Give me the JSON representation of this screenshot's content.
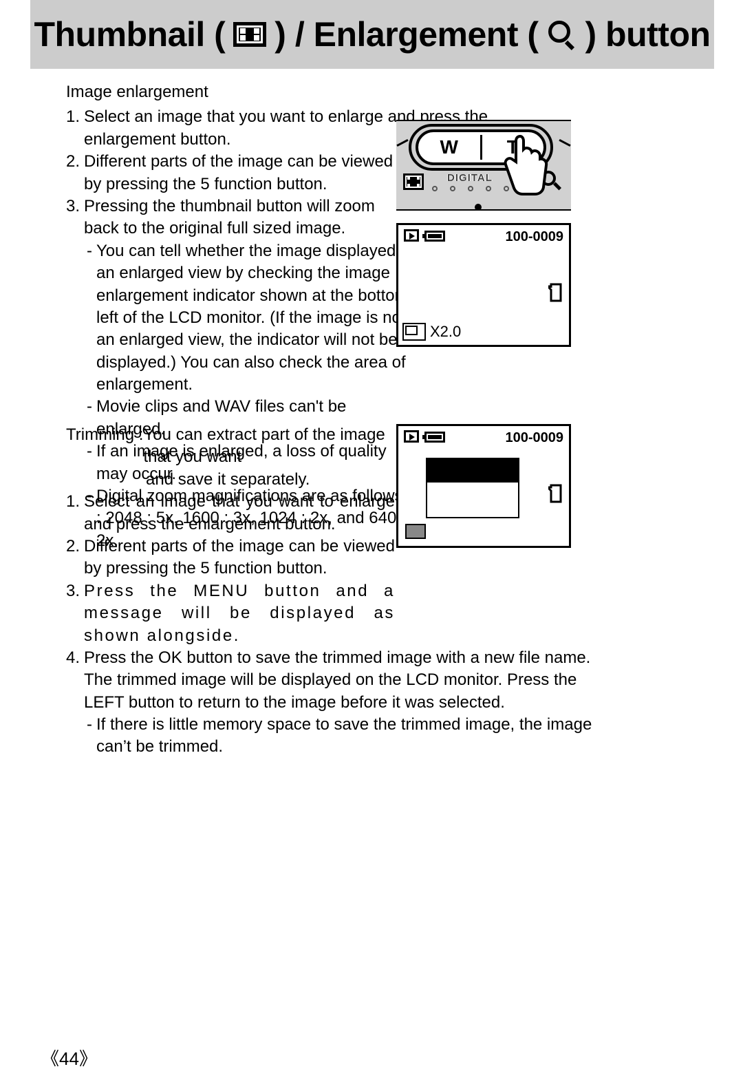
{
  "title": {
    "part1": "Thumbnail (",
    "part2": ") / Enlargement (",
    "part3": ") button"
  },
  "section1": {
    "heading": "Image enlargement",
    "items": [
      "Select an image that you want to enlarge and press the enlargement button.",
      "Different parts of the image can be viewed by pressing the 5 function button.",
      "Pressing the thumbnail button will zoom back to the original full sized image."
    ],
    "subitems": [
      "You can tell whether the image displayed is an enlarged view by checking the image enlargement indicator shown at the bottom left of the LCD monitor. (If the image is not an enlarged view, the indicator will not be displayed.) You can also check the area of enlargement.",
      "Movie clips and WAV files can't be enlarged.",
      "If an image is enlarged, a loss of quality may occur.",
      "Digital zoom magnifications are as follows"
    ],
    "zoom_ratios": ": 2048 : 5x, 1600 : 3x, 1024 : 2x, and 640 : 2x."
  },
  "illustration": {
    "w": "W",
    "t": "T",
    "digital": "DIGITAL"
  },
  "lcd": {
    "file_no": "100-0009",
    "zoom": "X2.0"
  },
  "section2": {
    "trim_label": "Trimming : ",
    "trim_intro1": "You can extract part of the image that you want",
    "trim_intro2": "and save it separately.",
    "items": [
      "Select an image that you want to enlarge and press the enlargement button.",
      "Different parts of the image can be viewed by pressing the 5 function button.",
      "Press the MENU button and a message will be displayed as shown alongside.",
      "Press the OK button to save the trimmed image with a new file name. The trimmed image will be displayed on the LCD monitor. Press the LEFT button to return to the image before it was selected."
    ],
    "note": "If there is little memory space to save the trimmed image, the image can’t be trimmed."
  },
  "page_number": "44"
}
